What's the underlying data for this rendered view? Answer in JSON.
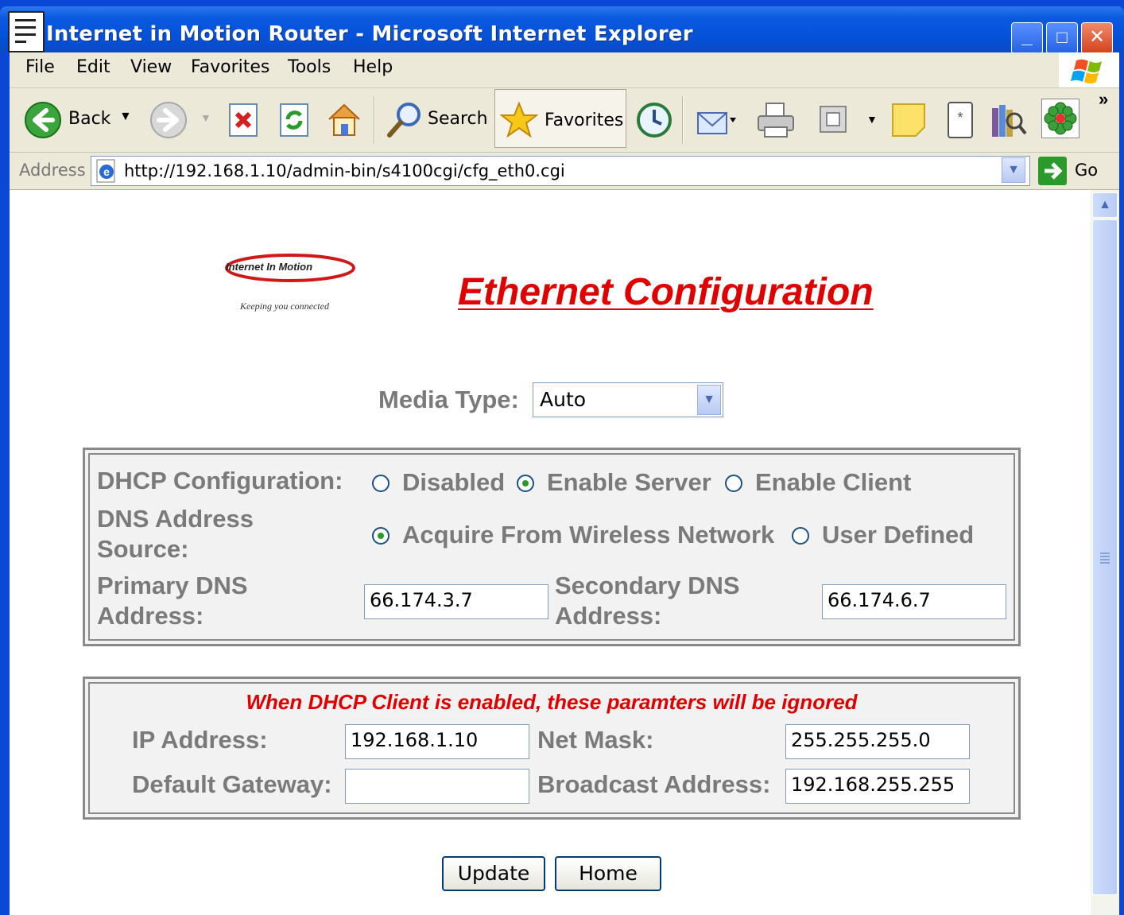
{
  "window": {
    "title": "Internet in Motion Router - Microsoft Internet Explorer",
    "minimize": "_",
    "maximize": "□",
    "close": "✕"
  },
  "menu": [
    "File",
    "Edit",
    "View",
    "Favorites",
    "Tools",
    "Help"
  ],
  "toolbar": {
    "back": "Back",
    "search": "Search",
    "favorites": "Favorites",
    "more": "»"
  },
  "address": {
    "label": "Address",
    "url": "http://192.168.1.10/admin-bin/s4100cgi/cfg_eth0.cgi",
    "go": "Go"
  },
  "page": {
    "logo_text": "Internet In Motion",
    "logo_tagline": "Keeping you connected",
    "heading": "Ethernet Configuration",
    "media_type_label": "Media Type:",
    "media_type_value": "Auto",
    "dhcp_label": "DHCP Configuration:",
    "dhcp_options": [
      "Disabled",
      "Enable Server",
      "Enable Client"
    ],
    "dhcp_selected": "Enable Server",
    "dns_source_label_1": "DNS Address",
    "dns_source_label_2": "Source:",
    "dns_options": [
      "Acquire From Wireless Network",
      "User Defined"
    ],
    "dns_selected": "Acquire From Wireless Network",
    "primary_dns_label_1": "Primary DNS",
    "primary_dns_label_2": "Address:",
    "primary_dns_value": "66.174.3.7",
    "secondary_dns_label_1": "Secondary DNS",
    "secondary_dns_label_2": "Address:",
    "secondary_dns_value": "66.174.6.7",
    "warning": "When DHCP Client is enabled, these paramters will be ignored",
    "ip_label": "IP Address:",
    "ip_value": "192.168.1.10",
    "netmask_label": "Net Mask:",
    "netmask_value": "255.255.255.0",
    "gateway_label": "Default Gateway:",
    "gateway_value": "",
    "broadcast_label": "Broadcast Address:",
    "broadcast_value": "192.168.255.255",
    "update_button": "Update",
    "home_button": "Home"
  },
  "colors": {
    "titlebar": "#0A59E0",
    "heading_red": "#E00000",
    "label_gray": "#7A7A7A",
    "chrome": "#ECE9D8"
  }
}
